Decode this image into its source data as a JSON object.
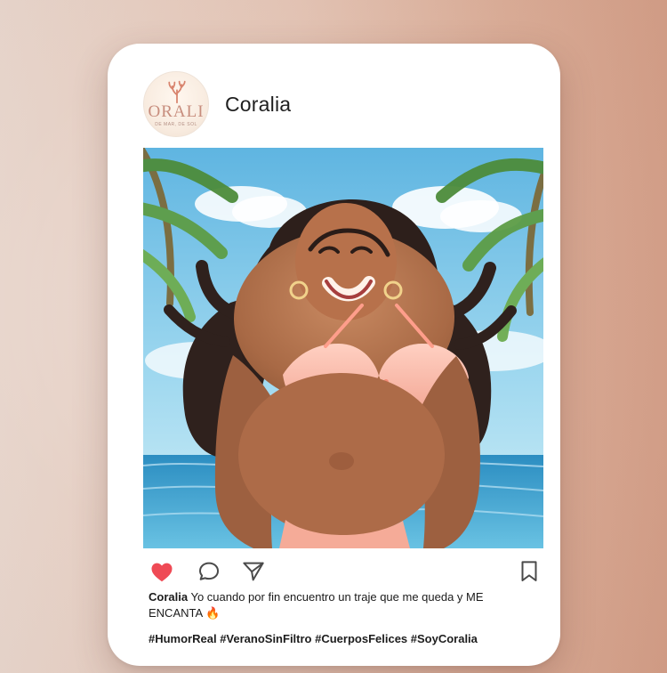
{
  "profile": {
    "username": "Coralia",
    "avatar_brand_text": "ORALI",
    "avatar_tagline_text": "DE MAR, DE SOL"
  },
  "post": {
    "caption_author": "Coralia",
    "caption_text": "Yo cuando por fin encuentro un traje que me queda y ME ENCANTA",
    "caption_emoji": "🔥",
    "hashtags": "#HumorReal #VeranoSinFiltro #CuerposFelices #SoyCoralia"
  },
  "icons": {
    "coral": "coral-icon",
    "like": "heart-icon",
    "comment": "comment-icon",
    "share": "send-icon",
    "save": "bookmark-icon"
  },
  "colors": {
    "heart": "#ef4a55",
    "outline": "#4a4a4a",
    "coral": "#d8836d"
  }
}
